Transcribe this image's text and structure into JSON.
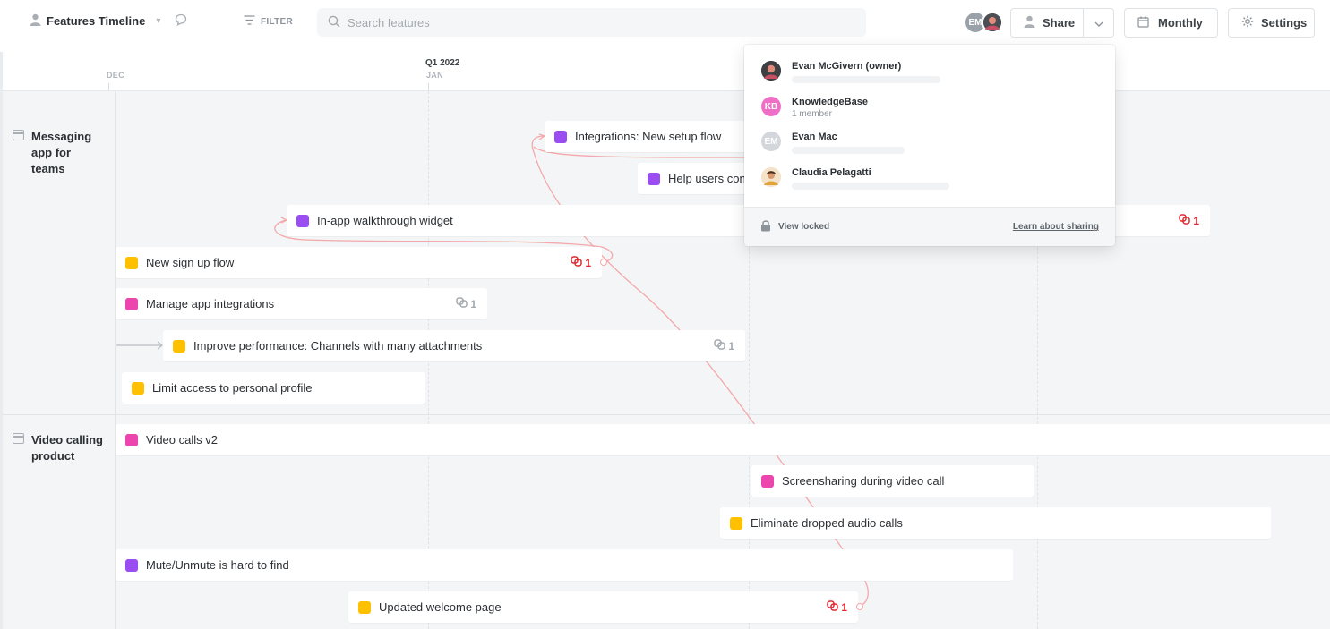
{
  "header": {
    "title": "Features Timeline",
    "filter_label": "FILTER",
    "search_placeholder": "Search features",
    "avatar_initials": "EM",
    "share_label": "Share",
    "monthly_label": "Monthly",
    "settings_label": "Settings"
  },
  "timeline": {
    "months": [
      {
        "label": "DEC"
      },
      {
        "label": "JAN",
        "quarter": "Q1 2022"
      }
    ]
  },
  "colors": {
    "purple": "#9a4ef1",
    "pink": "#ec45ae",
    "yellow": "#ffc000",
    "dependency_red": "#e0292e",
    "dependency_line": "#f4a8aa"
  },
  "lanes": [
    {
      "label": "Messaging app for teams"
    },
    {
      "label": "Video calling product"
    }
  ],
  "features": [
    {
      "label": "Integrations: New setup flow",
      "color": "purple"
    },
    {
      "label": "Help users cont",
      "color": "purple"
    },
    {
      "label": "In-app walkthrough widget",
      "color": "purple",
      "deps": "1"
    },
    {
      "label": "New sign up flow",
      "color": "yellow",
      "deps": "1"
    },
    {
      "label": "Manage app integrations",
      "color": "pink",
      "deps": "1"
    },
    {
      "label": "Improve performance: Channels with many attachments",
      "color": "yellow",
      "deps": "1"
    },
    {
      "label": "Limit access to personal profile",
      "color": "yellow"
    },
    {
      "label": "Video calls v2",
      "color": "pink"
    },
    {
      "label": "Screensharing during video call",
      "color": "pink"
    },
    {
      "label": "Eliminate dropped audio calls",
      "color": "yellow"
    },
    {
      "label": "Mute/Unmute is hard to find",
      "color": "purple"
    },
    {
      "label": "Updated welcome page",
      "color": "yellow",
      "deps": "1"
    }
  ],
  "share_popup": {
    "members": [
      {
        "name": "Evan McGivern (owner)",
        "sub": ""
      },
      {
        "name": "KnowledgeBase",
        "sub": "1 member",
        "initials": "KB"
      },
      {
        "name": "Evan Mac",
        "sub": "",
        "initials": "EM"
      },
      {
        "name": "Claudia Pelagatti",
        "sub": ""
      }
    ],
    "view_locked_label": "View locked",
    "learn_link": "Learn about sharing"
  }
}
